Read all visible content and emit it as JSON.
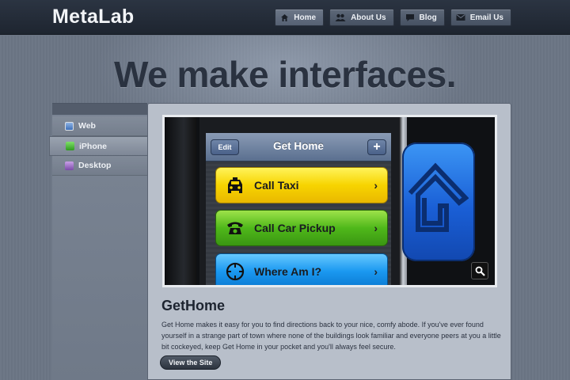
{
  "header": {
    "logo": "MetaLab",
    "nav": [
      {
        "label": "Home",
        "icon": "home-icon",
        "active": true
      },
      {
        "label": "About Us",
        "icon": "people-icon",
        "active": false
      },
      {
        "label": "Blog",
        "icon": "speech-bubble-icon",
        "active": false
      },
      {
        "label": "Email Us",
        "icon": "envelope-icon",
        "active": false
      }
    ]
  },
  "hero": {
    "headline": "We make interfaces."
  },
  "sidebar": {
    "items": [
      {
        "label": "Web",
        "icon": "web-icon",
        "active": false
      },
      {
        "label": "iPhone",
        "icon": "phone-icon",
        "active": true
      },
      {
        "label": "Desktop",
        "icon": "desktop-icon",
        "active": false
      }
    ]
  },
  "project": {
    "screenshot": {
      "app_title": "Get Home",
      "edit_label": "Edit",
      "add_label": "+",
      "buttons": [
        {
          "label": "Call Taxi",
          "icon": "taxi-icon",
          "color": "#f7d400"
        },
        {
          "label": "Call Car Pickup",
          "icon": "telephone-icon",
          "color": "#4fb81a"
        },
        {
          "label": "Where Am I?",
          "icon": "compass-icon",
          "color": "#1a98f0"
        }
      ],
      "chevron": "›"
    },
    "title": "GetHome",
    "description": "Get Home makes it easy for you to find directions back to your nice, comfy abode. If you've ever found yourself in a strange part of town where none of the buildings look familiar and everyone peers at you a little bit cockeyed, keep Get Home in your pocket and you'll always feel secure.",
    "button_label": "View the Site"
  }
}
